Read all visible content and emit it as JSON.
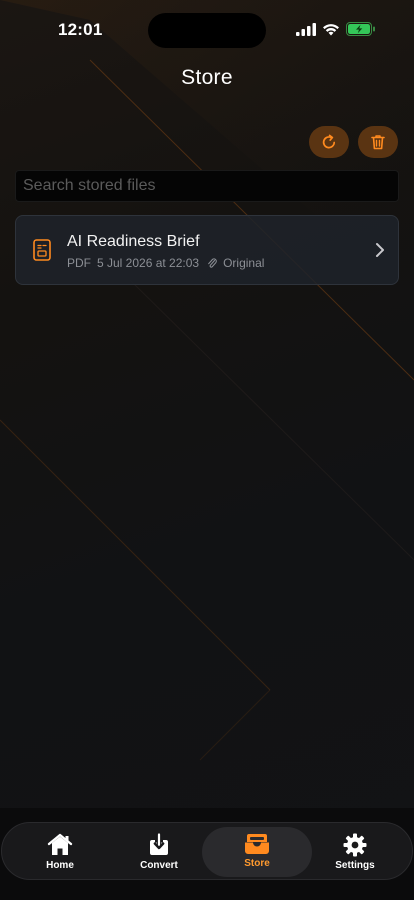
{
  "status_bar": {
    "time": "12:01"
  },
  "header": {
    "title": "Store"
  },
  "toolbar": {
    "refresh_icon": "refresh-icon",
    "trash_icon": "trash-icon",
    "accent": "#ff8a1f"
  },
  "search": {
    "placeholder": "Search stored files",
    "value": ""
  },
  "files": [
    {
      "name": "AI Readiness Brief",
      "type": "PDF",
      "date": "5 Jul 2026 at 22:03",
      "variant": "Original"
    }
  ],
  "tabs": [
    {
      "label": "Home",
      "icon": "home-icon",
      "active": false
    },
    {
      "label": "Convert",
      "icon": "download-icon",
      "active": false
    },
    {
      "label": "Store",
      "icon": "tray-icon",
      "active": true
    },
    {
      "label": "Settings",
      "icon": "gear-icon",
      "active": false
    }
  ]
}
